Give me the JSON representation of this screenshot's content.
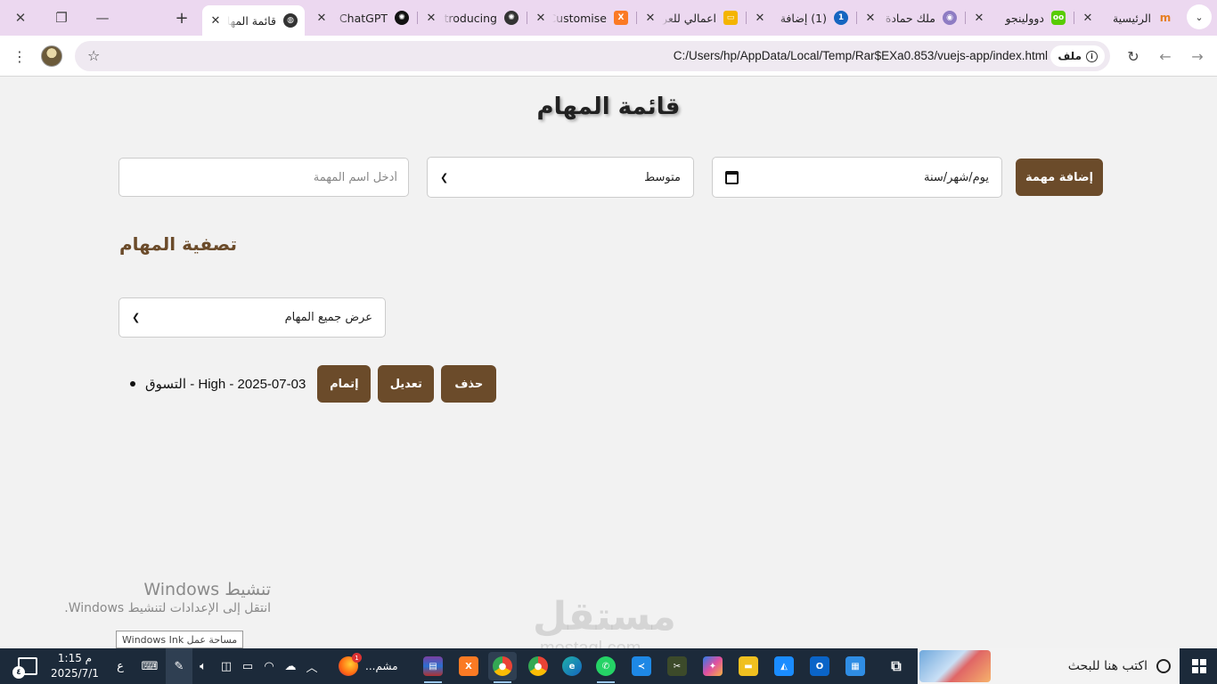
{
  "browser": {
    "tabs": [
      {
        "title": "الرئيسية",
        "favicon": "mostaql-favicon",
        "color": "#2a7fd4",
        "active": false
      },
      {
        "title": "دوولينجو",
        "favicon": "duolingo-favicon",
        "color": "#58cc02",
        "active": false
      },
      {
        "title": "ملك حمادة",
        "favicon": "profile-favicon",
        "color": "#8e7cc3",
        "active": false
      },
      {
        "title": "(1) إضافة",
        "favicon": "notification-favicon",
        "color": "#1565c0",
        "active": false
      },
      {
        "title": "اعمالي للعرض",
        "favicon": "slides-favicon",
        "color": "#f4b400",
        "active": false
      },
      {
        "title": "Customise",
        "favicon": "xampp-favicon",
        "color": "#fb7a24",
        "active": false
      },
      {
        "title": "Introducing",
        "favicon": "openai-favicon",
        "color": "#333333",
        "active": false
      },
      {
        "title": "ChatGPT",
        "favicon": "openai-favicon",
        "color": "#111111",
        "active": false
      },
      {
        "title": "قائمة المهام",
        "favicon": "globe-favicon",
        "color": "#333333",
        "active": true
      }
    ],
    "address": {
      "url": "C:/Users/hp/AppData/Local/Temp/Rar$EXa0.853/vuejs-app/index.html",
      "chip_label": "ملف"
    }
  },
  "app": {
    "title": "قائمة المهام",
    "form": {
      "name_placeholder": "أدخل اسم المهمة",
      "priority_value": "متوسط",
      "date_value": "يوم/شهر/سنة",
      "add_button": "إضافة مهمة"
    },
    "filter": {
      "heading": "تصفية المهام",
      "select_value": "عرض جميع المهام"
    },
    "tasks": [
      {
        "text": "التسوق - High - 2025-07-03",
        "complete_label": "إتمام",
        "edit_label": "تعديل",
        "delete_label": "حذف"
      }
    ]
  },
  "overlay": {
    "activate_title": "تنشيط Windows",
    "activate_subtitle": "انتقل إلى الإعدادات لتنشيط Windows.",
    "ink_tooltip": "مساحة عمل Windows Ink",
    "watermark": "مستقل",
    "watermark_sub": "mostaql.com"
  },
  "taskbar": {
    "search_placeholder": "اكتب هنا للبحث",
    "time": "1:15 م",
    "date": "2025/7/1",
    "language": "ع",
    "notification_count": "٤",
    "firefox_label": "مشم...",
    "firefox_badge": "1",
    "chrome_badge": "٤"
  }
}
